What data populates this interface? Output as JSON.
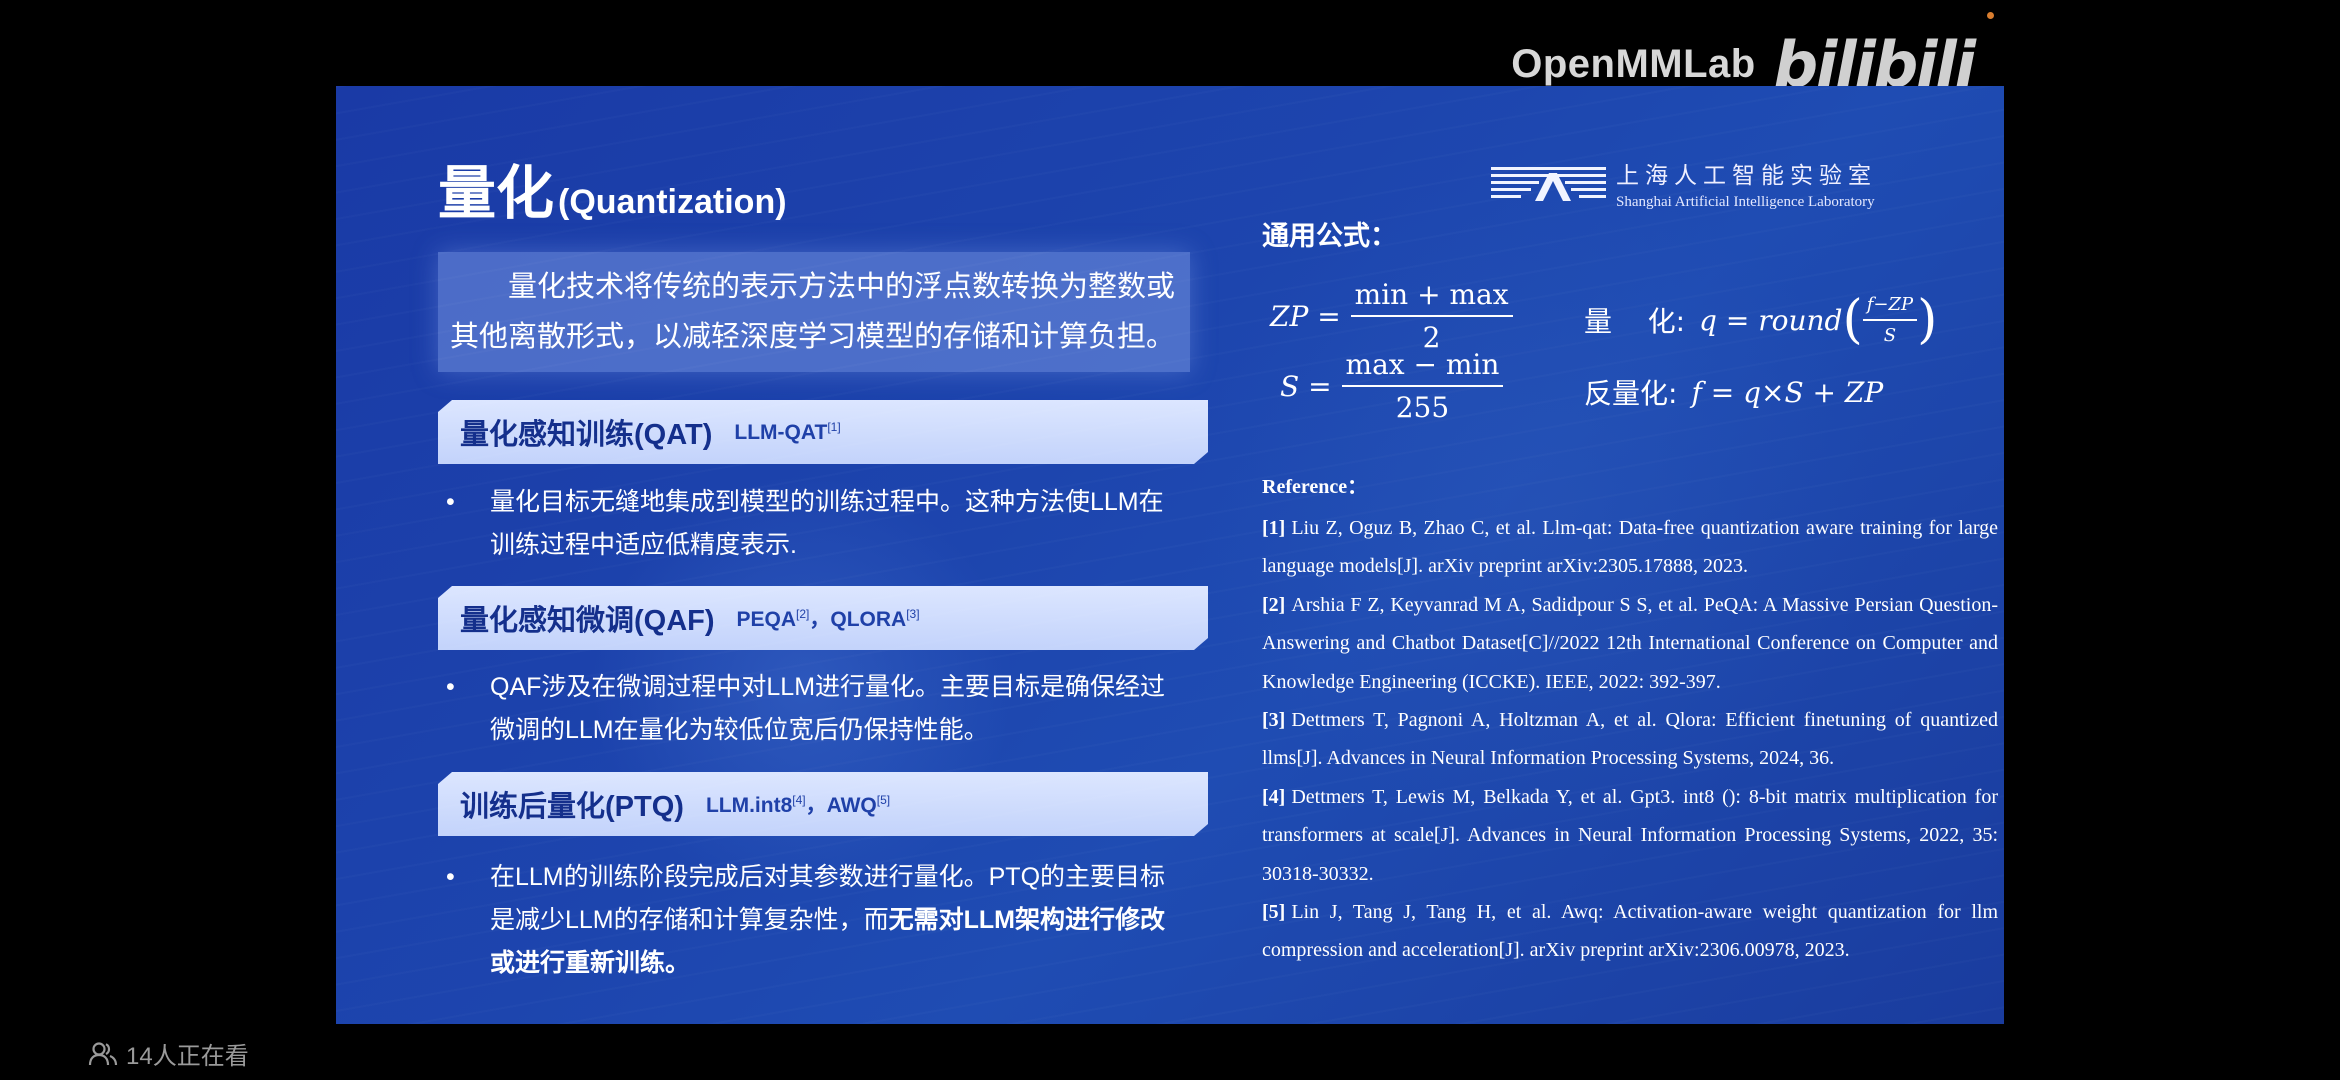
{
  "player": {
    "brand_name": "OpenMMLab",
    "site_logo": "bilibili",
    "viewers_text": "14人正在看",
    "viewers_icon": "people-icon"
  },
  "slide": {
    "title_zh": "量化",
    "title_en": "(Quantization)",
    "lab_name_zh": "上海人工智能实验室",
    "lab_name_en": "Shanghai Artificial Intelligence Laboratory",
    "intro": "量化技术将传统的表示方法中的浮点数转换为整数或其他离散形式，以减轻深度学习模型的存储和计算负担。",
    "sections": [
      {
        "title": "量化感知训练(QAT)",
        "method1": "LLM-QAT",
        "sup1": "[1]",
        "sep": "",
        "method2": "",
        "sup2": "",
        "bullet": "量化目标无缝地集成到模型的训练过程中。这种方法使LLM在训练过程中适应低精度表示."
      },
      {
        "title": "量化感知微调(QAF)",
        "method1": "PEQA",
        "sup1": "[2]",
        "sep": "，",
        "method2": "QLORA",
        "sup2": "[3]",
        "bullet": "QAF涉及在微调过程中对LLM进行量化。主要目标是确保经过微调的LLM在量化为较低位宽后仍保持性能。"
      },
      {
        "title": "训练后量化(PTQ)",
        "method1": "LLM.int8",
        "sup1": "[4]",
        "sep": "，",
        "method2": "AWQ",
        "sup2": "[5]",
        "bullet": "在LLM的训练阶段完成后对其参数进行量化。PTQ的主要目标是减少LLM的存储和计算复杂性，而",
        "bullet_bold": "无需对LLM架构进行修改或进行重新训练。"
      }
    ],
    "formula_title": "通用公式：",
    "formulas": {
      "zp_lhs": "ZP =",
      "zp_num": "min + max",
      "zp_den": "2",
      "s_lhs": "S =",
      "s_num": "max − min",
      "s_den": "255",
      "quant_label": "量    化:",
      "quant_expr": "q = round",
      "quant_num": "f−ZP",
      "quant_den": "S",
      "dequant_label": "反量化:",
      "dequant_expr": "f = q×S + ZP"
    },
    "reference_heading": "Reference：",
    "references": [
      {
        "num": "[1]",
        "text": "Liu Z, Oguz B, Zhao C, et al. Llm-qat: Data-free quantization aware training for large language models[J]. arXiv preprint arXiv:2305.17888, 2023."
      },
      {
        "num": "[2]",
        "text": "Arshia F Z, Keyvanrad M A, Sadidpour S S, et al. PeQA: A Massive Persian Question-Answering and Chatbot Dataset[C]//2022 12th International Conference on Computer and Knowledge Engineering (ICCKE). IEEE, 2022: 392-397."
      },
      {
        "num": "[3]",
        "text": "Dettmers T, Pagnoni A, Holtzman A, et al. Qlora: Efficient finetuning of quantized llms[J]. Advances in Neural Information Processing Systems, 2024, 36."
      },
      {
        "num": "[4]",
        "text": "Dettmers T, Lewis M, Belkada Y, et al. Gpt3. int8 (): 8-bit matrix multiplication for transformers at scale[J]. Advances in Neural Information Processing Systems, 2022, 35: 30318-30332."
      },
      {
        "num": "[5]",
        "text": "Lin J, Tang J, Tang H, et al. Awq: Activation-aware weight quantization for llm compression and acceleration[J]. arXiv preprint arXiv:2306.00978, 2023."
      }
    ]
  }
}
